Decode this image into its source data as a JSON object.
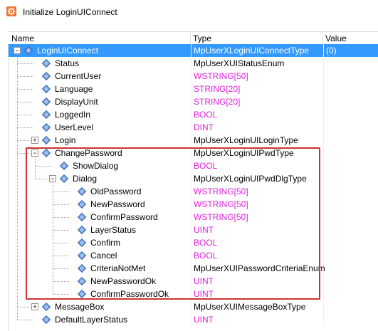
{
  "window": {
    "title": "Initialize LoginUIConnect",
    "icon": "settings-gear-icon"
  },
  "columns": {
    "name": "Name",
    "type": "Type",
    "value": "Value"
  },
  "colors": {
    "selection": "#3399ff",
    "primitive_type": "#e020e0",
    "highlight_box": "#cc3333"
  },
  "rows": [
    {
      "name": "LoginUIConnect",
      "type": "MpUserXLoginUIConnectType",
      "value": "(0)",
      "level": 0,
      "expander": "minus",
      "selected": true
    },
    {
      "name": "Status",
      "type": "MpUserXUIStatusEnum",
      "level": 1
    },
    {
      "name": "CurrentUser",
      "type": "WSTRING[50]",
      "level": 1,
      "primitive": true
    },
    {
      "name": "Language",
      "type": "STRING[20]",
      "level": 1,
      "primitive": true
    },
    {
      "name": "DisplayUnit",
      "type": "STRING[20]",
      "level": 1,
      "primitive": true
    },
    {
      "name": "LoggedIn",
      "type": "BOOL",
      "level": 1,
      "primitive": true
    },
    {
      "name": "UserLevel",
      "type": "DINT",
      "level": 1,
      "primitive": true
    },
    {
      "name": "Login",
      "type": "MpUserXLoginUILoginType",
      "level": 1,
      "expander": "plus"
    },
    {
      "name": "ChangePassword",
      "type": "MpUserXLoginUIPwdType",
      "level": 1,
      "expander": "minus"
    },
    {
      "name": "ShowDialog",
      "type": "BOOL",
      "level": 2,
      "primitive": true
    },
    {
      "name": "Dialog",
      "type": "MpUserXLoginUIPwdDlgType",
      "level": 2,
      "expander": "minus"
    },
    {
      "name": "OldPassword",
      "type": "WSTRING[50]",
      "level": 3,
      "primitive": true
    },
    {
      "name": "NewPassword",
      "type": "WSTRING[50]",
      "level": 3,
      "primitive": true
    },
    {
      "name": "ConfirmPassword",
      "type": "WSTRING[50]",
      "level": 3,
      "primitive": true
    },
    {
      "name": "LayerStatus",
      "type": "UINT",
      "level": 3,
      "primitive": true
    },
    {
      "name": "Confirm",
      "type": "BOOL",
      "level": 3,
      "primitive": true
    },
    {
      "name": "Cancel",
      "type": "BOOL",
      "level": 3,
      "primitive": true
    },
    {
      "name": "CriteriaNotMet",
      "type": "MpUserXUIPasswordCriteriaEnum",
      "level": 3
    },
    {
      "name": "NewPasswordOk",
      "type": "UINT",
      "level": 3,
      "primitive": true
    },
    {
      "name": "ConfirmPasswordOk",
      "type": "UINT",
      "level": 3,
      "primitive": true
    },
    {
      "name": "MessageBox",
      "type": "MpUserXUIMessageBoxType",
      "level": 1,
      "expander": "plus"
    },
    {
      "name": "DefaultLayerStatus",
      "type": "UINT",
      "level": 1,
      "primitive": true
    }
  ]
}
